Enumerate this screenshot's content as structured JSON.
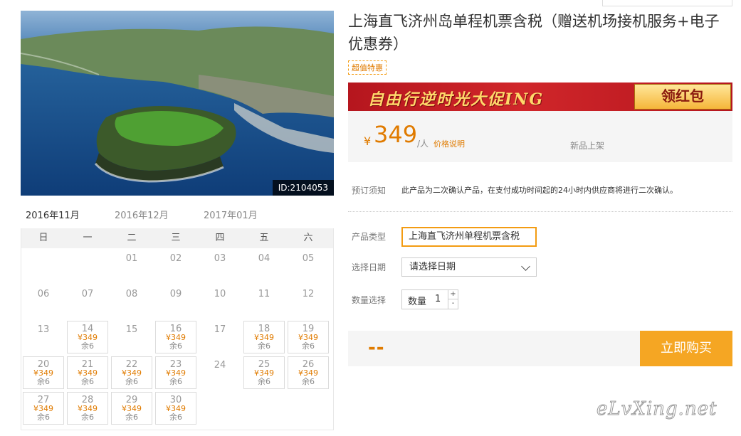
{
  "product": {
    "title": "上海直飞济州岛单程机票含税（赠送机场接机服务+电子优惠券）",
    "tag": "超值特惠",
    "photo_id": "ID:2104053"
  },
  "banner": {
    "text": "自由行逆时光大促ING",
    "button": "领红包",
    "colors": {
      "bg": "#c81e24",
      "text": "#ffd86b"
    }
  },
  "pricing": {
    "currency": "¥",
    "price": "349",
    "per": "/人",
    "price_note": "价格说明",
    "new_label": "新品上架"
  },
  "notice": {
    "label": "预订须知",
    "text": "此产品为二次确认产品，在支付成功时间起的24小时内供应商将进行二次确认。"
  },
  "form": {
    "type_label": "产品类型",
    "type_value": "上海直飞济州单程机票含税",
    "date_label": "选择日期",
    "date_placeholder": "请选择日期",
    "qty_label": "数量选择",
    "qty_inner_label": "数量",
    "qty_value": "1",
    "plus": "+",
    "minus": "-"
  },
  "buy": {
    "total": "--",
    "button": "立即购买",
    "accent": "#f5a623"
  },
  "calendar": {
    "months": [
      "2016年11月",
      "2016年12月",
      "2017年01月"
    ],
    "active_month": 0,
    "weekdays": [
      "日",
      "一",
      "二",
      "三",
      "四",
      "五",
      "六"
    ],
    "leading_blanks": 2,
    "days": [
      {
        "d": "01"
      },
      {
        "d": "02"
      },
      {
        "d": "03"
      },
      {
        "d": "04"
      },
      {
        "d": "05"
      },
      {
        "d": "06"
      },
      {
        "d": "07"
      },
      {
        "d": "08"
      },
      {
        "d": "09"
      },
      {
        "d": "10"
      },
      {
        "d": "11"
      },
      {
        "d": "12"
      },
      {
        "d": "13"
      },
      {
        "d": "14",
        "price": "¥349",
        "stock": "余6"
      },
      {
        "d": "15"
      },
      {
        "d": "16",
        "price": "¥349",
        "stock": "余6"
      },
      {
        "d": "17"
      },
      {
        "d": "18",
        "price": "¥349",
        "stock": "余6"
      },
      {
        "d": "19",
        "price": "¥349",
        "stock": "余6"
      },
      {
        "d": "20",
        "price": "¥349",
        "stock": "余6"
      },
      {
        "d": "21",
        "price": "¥349",
        "stock": "余6"
      },
      {
        "d": "22",
        "price": "¥349",
        "stock": "余6"
      },
      {
        "d": "23",
        "price": "¥349",
        "stock": "余6"
      },
      {
        "d": "24"
      },
      {
        "d": "25",
        "price": "¥349",
        "stock": "余6"
      },
      {
        "d": "26",
        "price": "¥349",
        "stock": "余6"
      },
      {
        "d": "27",
        "price": "¥349",
        "stock": "余6"
      },
      {
        "d": "28",
        "price": "¥349",
        "stock": "余6"
      },
      {
        "d": "29",
        "price": "¥349",
        "stock": "余6"
      },
      {
        "d": "30",
        "price": "¥349",
        "stock": "余6"
      }
    ]
  },
  "watermark": "eLvXing.net"
}
